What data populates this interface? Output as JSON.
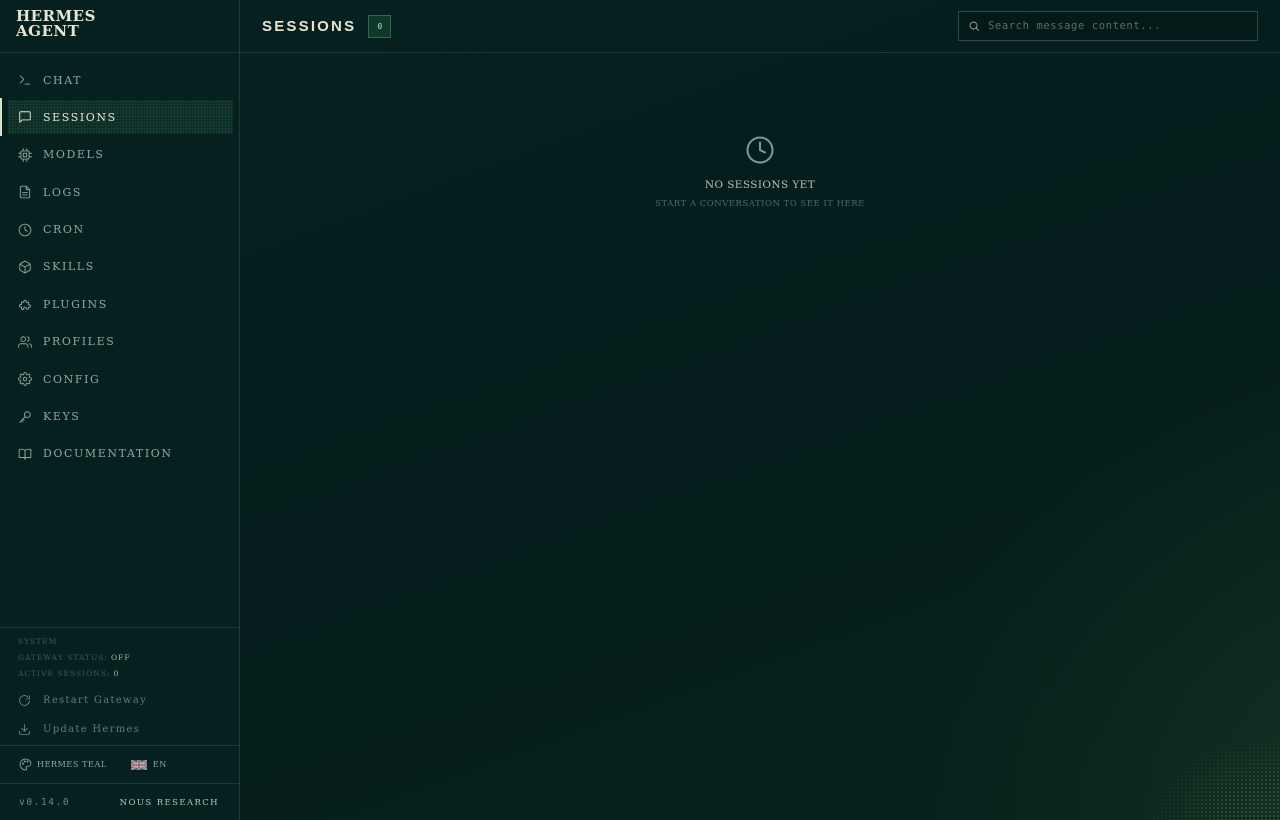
{
  "brand": {
    "line1": "HERMES",
    "line2": "AGENT"
  },
  "nav": {
    "items": [
      {
        "label": "CHAT",
        "icon": "terminal-icon"
      },
      {
        "label": "SESSIONS",
        "icon": "message-square-icon",
        "active": true
      },
      {
        "label": "MODELS",
        "icon": "cpu-icon"
      },
      {
        "label": "LOGS",
        "icon": "file-text-icon"
      },
      {
        "label": "CRON",
        "icon": "clock-icon"
      },
      {
        "label": "SKILLS",
        "icon": "package-icon"
      },
      {
        "label": "PLUGINS",
        "icon": "puzzle-icon"
      },
      {
        "label": "PROFILES",
        "icon": "users-icon"
      },
      {
        "label": "CONFIG",
        "icon": "settings-icon"
      },
      {
        "label": "KEYS",
        "icon": "key-icon"
      },
      {
        "label": "DOCUMENTATION",
        "icon": "book-icon"
      }
    ]
  },
  "system": {
    "title": "SYSTEM",
    "gateway_label": "GATEWAY STATUS:",
    "gateway_value": "OFF",
    "sessions_label": "ACTIVE SESSIONS:",
    "sessions_value": "0",
    "restart_label": "Restart Gateway",
    "update_label": "Update Hermes"
  },
  "prefs": {
    "theme_label": "HERMES TEAL",
    "language_label": "EN"
  },
  "footer": {
    "version": "v0.14.0",
    "org_link": "NOUS RESEARCH"
  },
  "header": {
    "title": "SESSIONS",
    "count": "0"
  },
  "search": {
    "placeholder": "Search message content...",
    "value": ""
  },
  "empty_state": {
    "title": "NO SESSIONS YET",
    "subtitle": "START A CONVERSATION TO SEE IT HERE"
  },
  "colors": {
    "background": "#041c1c",
    "accent": "#e8e4d2",
    "muted": "#8fa79d",
    "border": "#1d3a36"
  }
}
